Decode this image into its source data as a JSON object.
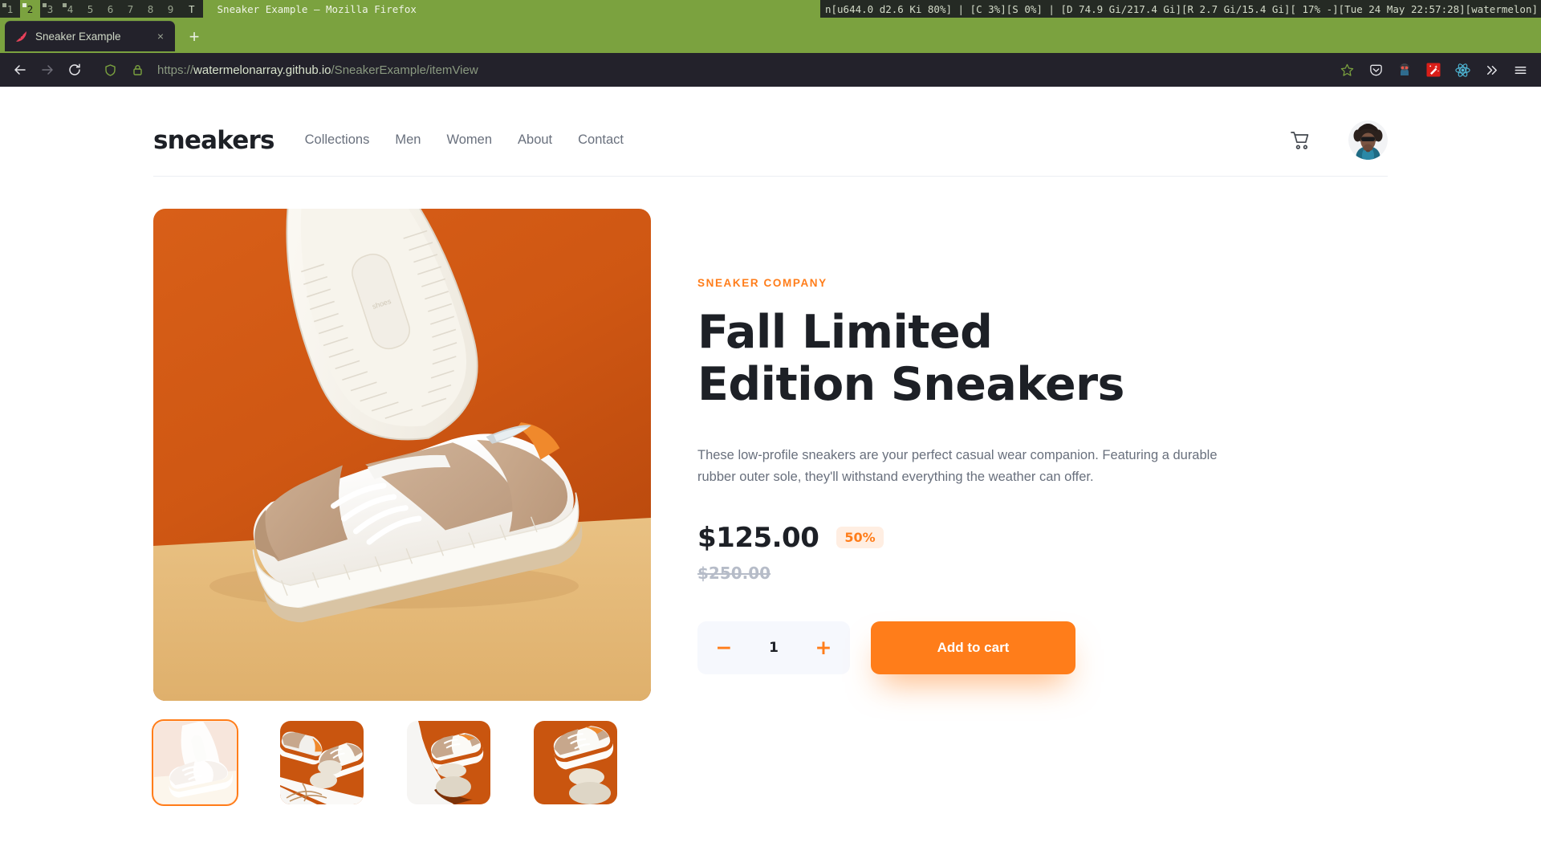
{
  "wm": {
    "tags": [
      {
        "label": "1",
        "state": "occupied"
      },
      {
        "label": "2",
        "state": "selected"
      },
      {
        "label": "3",
        "state": "occupied"
      },
      {
        "label": "4",
        "state": "occupied"
      },
      {
        "label": "5",
        "state": "empty"
      },
      {
        "label": "6",
        "state": "empty"
      },
      {
        "label": "7",
        "state": "empty"
      },
      {
        "label": "8",
        "state": "empty"
      },
      {
        "label": "9",
        "state": "empty"
      }
    ],
    "layout": "T",
    "window_title": "Sneaker Example — Mozilla Firefox",
    "status": "n[u644.0  d2.6 Ki 80%] | [C   3%][S  0%] | [D 74.9 Gi/217.4 Gi][R 2.7 Gi/15.4 Gi][ 17%  -][Tue 24 May 22:57:28][watermelon]"
  },
  "browser": {
    "tab": {
      "title": "Sneaker Example",
      "favicon": "watermelon-icon",
      "close": "×"
    },
    "new_tab_label": "+",
    "nav": {
      "back": "back-arrow-icon",
      "forward": "forward-arrow-icon",
      "reload": "reload-icon",
      "shield": "shield-icon",
      "lock": "lock-icon"
    },
    "url": {
      "scheme": "https://",
      "host": "watermelonarray.github.io",
      "path": "/SneakerExample/itemView",
      "full": "https://watermelonarray.github.io/SneakerExample/itemView"
    },
    "toolbar_icons": [
      "bookmark-star-icon",
      "pocket-icon",
      "robot-extension-icon",
      "magic-wand-extension-icon",
      "react-devtools-icon",
      "overflow-chevrons-icon",
      "hamburger-menu-icon"
    ]
  },
  "site": {
    "brand": "sneakers",
    "nav_links": [
      "Collections",
      "Men",
      "Women",
      "About",
      "Contact"
    ],
    "cart_icon": "shopping-cart-icon",
    "avatar_alt": "user-avatar"
  },
  "product": {
    "eyebrow": "SNEAKER COMPANY",
    "title": "Fall Limited Edition Sneakers",
    "description": "These low-profile sneakers are your perfect casual wear companion. Featuring a durable rubber outer sole, they'll withstand everything the weather can offer.",
    "price": "$125.00",
    "discount": "50%",
    "old_price": "$250.00",
    "quantity": "1",
    "decrement_label": "−",
    "increment_label": "+",
    "add_to_cart_label": "Add to cart",
    "thumbnails": [
      {
        "name": "thumbnail-1",
        "active": true
      },
      {
        "name": "thumbnail-2",
        "active": false
      },
      {
        "name": "thumbnail-3",
        "active": false
      },
      {
        "name": "thumbnail-4",
        "active": false
      }
    ]
  },
  "colors": {
    "accent": "#ff7d1a",
    "accent_soft": "#ffeee2",
    "text_dark": "#1d2026",
    "text_muted": "#69707d",
    "wm_green": "#7ba23f",
    "chrome_dark": "#23222b"
  }
}
